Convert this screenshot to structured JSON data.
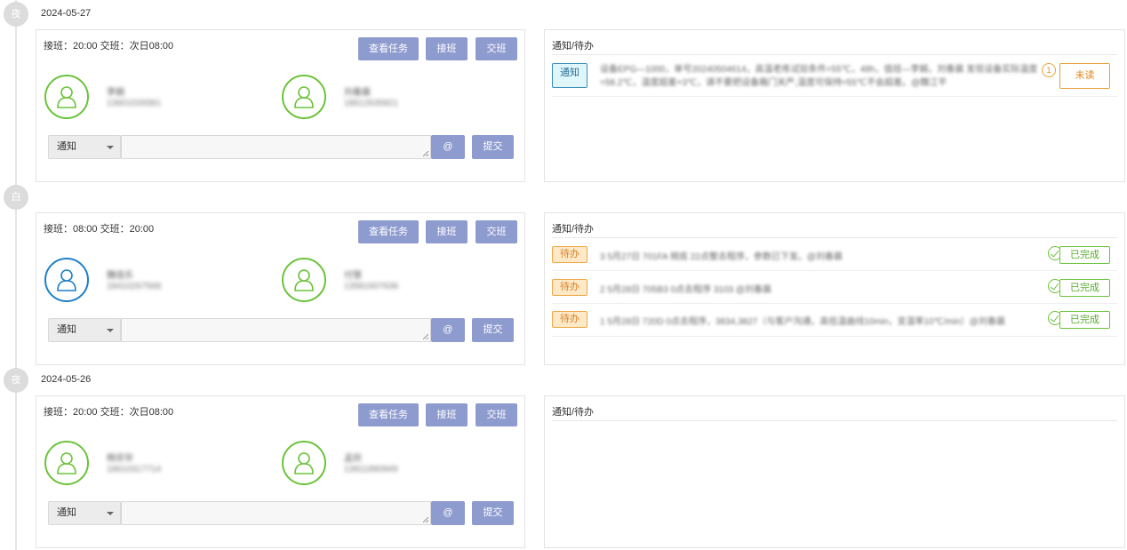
{
  "timeline": [
    {
      "node": "夜",
      "date": "2024-05-27",
      "shift_title": "接班：20:00 交班：次日08:00",
      "buttons": {
        "view_tasks": "查看任务",
        "take_shift": "接班",
        "hand_over": "交班",
        "at": "@",
        "submit": "提交"
      },
      "persons": [
        {
          "name": "李娟",
          "phone": "13601026581",
          "avatar_color": "#6bc33a"
        },
        {
          "name": "刘春晨",
          "phone": "18612635821",
          "avatar_color": "#6bc33a"
        }
      ],
      "select_value": "通知",
      "message_value": "",
      "notices": {
        "title": "通知/待办",
        "items": [
          {
            "tag": "通知",
            "tag_type": "info",
            "text": "设备EPG—1000，单号20240504614，高温老练试验条件=55℃，48h，值班—李娟，刘春晨 发现设备实际温度=58.2℃，温度超差+3℃，请不要把设备箱门关严,温度可保持=55℃不会超差。@魏江平",
            "indicator": "1",
            "status": "未读",
            "status_type": "unread"
          }
        ]
      }
    },
    {
      "node": "白",
      "date": "",
      "shift_title": "接班：08:00 交班：20:00",
      "buttons": {
        "view_tasks": "查看任务",
        "take_shift": "接班",
        "hand_over": "交班",
        "at": "@",
        "submit": "提交"
      },
      "persons": [
        {
          "name": "魏佳乐",
          "phone": "18410267568",
          "avatar_color": "#1e7fc8"
        },
        {
          "name": "付慧",
          "phone": "13581607636",
          "avatar_color": "#6bc33a"
        }
      ],
      "select_value": "通知",
      "message_value": "",
      "notices": {
        "title": "通知/待办",
        "items": [
          {
            "tag": "待办",
            "tag_type": "todo",
            "text": "3 5月27日 701FA 频底 22点整去程序，参数已下发。@刘春晨",
            "indicator": "",
            "status": "已完成",
            "status_type": "done"
          },
          {
            "tag": "待办",
            "tag_type": "todo",
            "text": "2 5月28日 705B3 0点去程序 3103 @刘春晨",
            "indicator": "",
            "status": "已完成",
            "status_type": "done"
          },
          {
            "tag": "待办",
            "tag_type": "todo",
            "text": "1 5月28日 720D 0点去程序，3834,3827（与客户沟通，高低温曲线10min，变温率10℃/min）@刘春晨",
            "indicator": "",
            "status": "已完成",
            "status_type": "done"
          }
        ]
      }
    },
    {
      "node": "夜",
      "date": "2024-05-26",
      "shift_title": "接班：20:00 交班：次日08:00",
      "buttons": {
        "view_tasks": "查看任务",
        "take_shift": "接班",
        "hand_over": "交班",
        "at": "@",
        "submit": "提交"
      },
      "persons": [
        {
          "name": "杨宗华",
          "phone": "18610317714",
          "avatar_color": "#6bc33a"
        },
        {
          "name": "孟欣",
          "phone": "13911890949",
          "avatar_color": "#6bc33a"
        }
      ],
      "select_value": "通知",
      "message_value": "",
      "notices": {
        "title": "通知/待办",
        "items": []
      }
    }
  ]
}
